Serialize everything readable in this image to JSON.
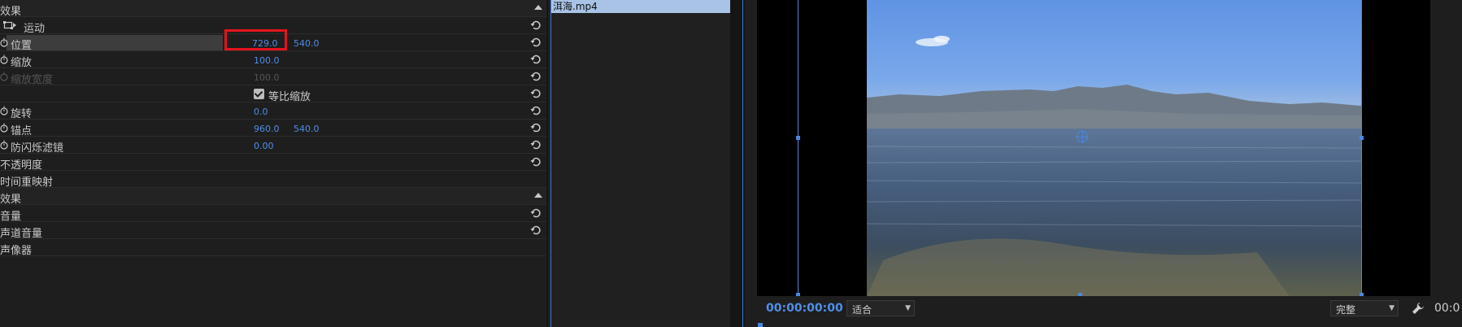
{
  "effects_panel": {
    "video_section_label": "效果",
    "motion_label": "运动",
    "position": {
      "label": "位置",
      "x": "729.0",
      "y": "540.0"
    },
    "scale": {
      "label": "缩放",
      "value": "100.0"
    },
    "scale_width": {
      "label": "缩放宽度",
      "value": "100.0"
    },
    "uniform_scale_label": "等比缩放",
    "rotation": {
      "label": "旋转",
      "value": "0.0"
    },
    "anchor_point": {
      "label": "锚点",
      "x": "960.0",
      "y": "540.0"
    },
    "anti_flicker": {
      "label": "防闪烁滤镜",
      "value": "0.00"
    },
    "opacity_label": "不透明度",
    "time_remap_label": "时间重映射",
    "audio_section_label": "效果",
    "volume_label": "音量",
    "channel_volume_label": "声道音量",
    "panner_label": "声像器"
  },
  "timeline": {
    "clip_name": "洱海.mp4"
  },
  "monitor": {
    "timecode": "00:00:00:00",
    "fit_option": "适合",
    "quality_option": "完整",
    "timecode_right": "00:0"
  },
  "colors": {
    "accent": "#4f8ee8",
    "highlight_box": "#e5141c"
  }
}
